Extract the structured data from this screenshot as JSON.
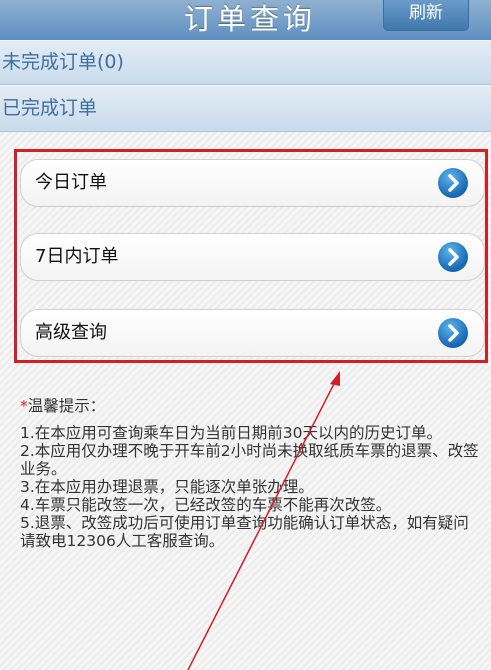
{
  "header": {
    "title": "订单查询",
    "refresh_label": "刷新"
  },
  "sections": {
    "pending": "未完成订单(0)",
    "completed": "已完成订单"
  },
  "menu": [
    {
      "label": "今日订单"
    },
    {
      "label": "7日内订单"
    },
    {
      "label": "高级查询"
    }
  ],
  "tips": {
    "star": "*",
    "title": "温馨提示：",
    "items": [
      "1.在本应用可查询乘车日为当前日期前30天以内的历史订单。",
      "2.本应用仅办理不晚于开车前2小时尚未换取纸质车票的退票、改签业务。",
      "3.在本应用办理退票，只能逐次单张办理。",
      "4.车票只能改签一次，已经改签的车票不能再次改签。",
      "5.退票、改签成功后可使用订单查询功能确认订单状态，如有疑问请致电12306人工客服查询。"
    ]
  },
  "colors": {
    "header": "#5f8fc0",
    "section_text": "#3f6f9d",
    "highlight": "#d01f26",
    "arrow_button": "#1e7fc7"
  },
  "icons": {
    "menu_arrow": "chevron-right-circle-icon"
  }
}
